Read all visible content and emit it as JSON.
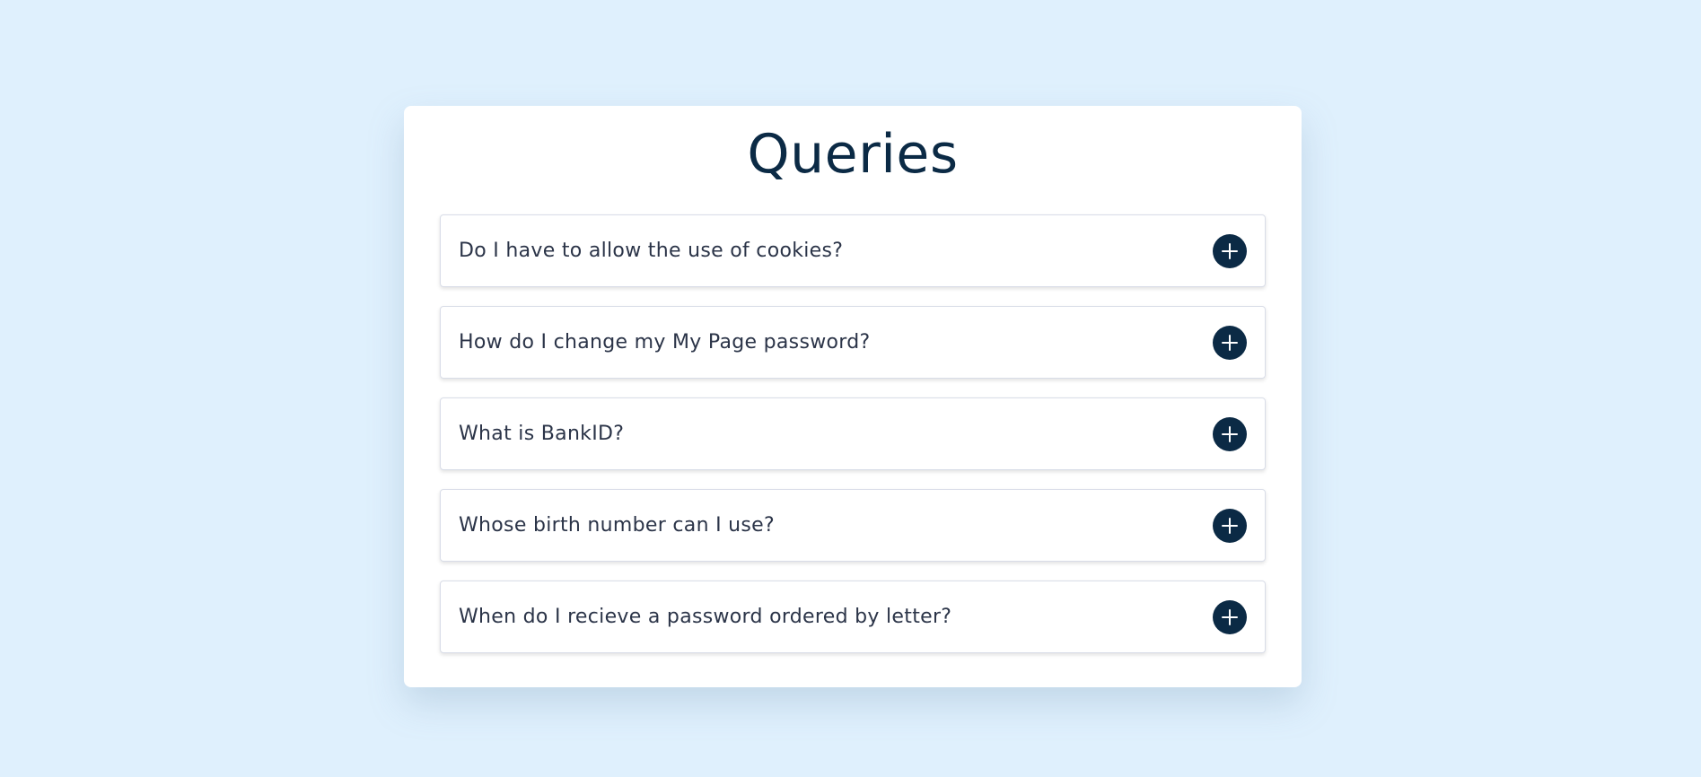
{
  "page": {
    "title": "Queries"
  },
  "faq": {
    "items": [
      {
        "question": "Do I have to allow the use of cookies?",
        "icon": "plus-icon"
      },
      {
        "question": "How do I change my My Page password?",
        "icon": "plus-icon"
      },
      {
        "question": "What is BankID?",
        "icon": "plus-icon"
      },
      {
        "question": "Whose birth number can I use?",
        "icon": "plus-icon"
      },
      {
        "question": "When do I recieve a password ordered by letter?",
        "icon": "plus-icon"
      }
    ]
  },
  "colors": {
    "background": "#dff0fd",
    "card": "#ffffff",
    "accent": "#0b2a45",
    "question_text": "#2b3448"
  }
}
